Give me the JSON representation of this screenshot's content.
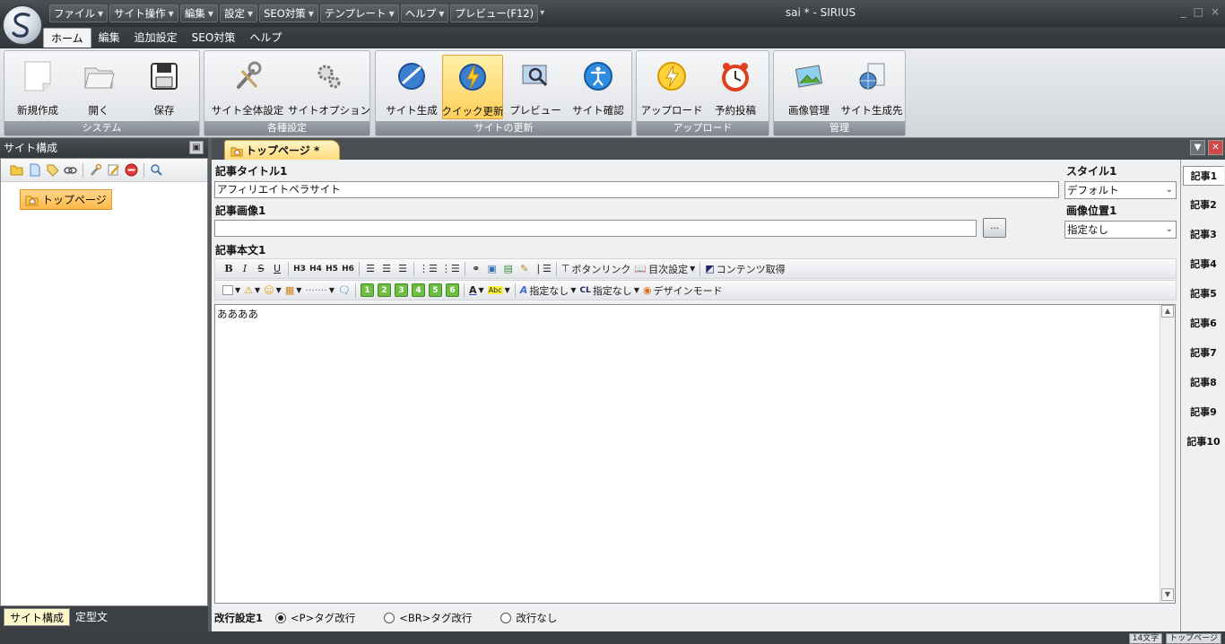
{
  "window": {
    "title": "sai * - SIRIUS",
    "minimize": "_",
    "maximize": "□",
    "close": "×"
  },
  "quick_access": [
    "ファイル",
    "サイト操作",
    "編集",
    "設定",
    "SEO対策",
    "テンプレート",
    "ヘルプ",
    "プレビュー(F12)"
  ],
  "ribbon_tabs": [
    "ホーム",
    "編集",
    "追加設定",
    "SEO対策",
    "ヘルプ"
  ],
  "ribbon": {
    "groups": [
      {
        "label": "システム",
        "buttons": [
          "新規作成",
          "開く",
          "保存"
        ]
      },
      {
        "label": "各種設定",
        "buttons": [
          "サイト全体設定",
          "サイトオプション"
        ]
      },
      {
        "label": "サイトの更新",
        "buttons": [
          "サイト生成",
          "クイック更新",
          "プレビュー",
          "サイト確認"
        ]
      },
      {
        "label": "アップロード",
        "buttons": [
          "アップロード",
          "予約投稿"
        ]
      },
      {
        "label": "管理",
        "buttons": [
          "画像管理",
          "サイト生成先"
        ]
      }
    ]
  },
  "left_panel": {
    "title": "サイト構成",
    "tree_root": "トップページ",
    "bottom_tabs": [
      "サイト構成",
      "定型文"
    ]
  },
  "doc_tab": "トップページ *",
  "editor": {
    "title_label": "記事タイトル1",
    "title_value": "アフィリエイトペラサイト",
    "style_label": "スタイル1",
    "style_value": "デフォルト",
    "image_label": "記事画像1",
    "image_value": "",
    "browse_label": "...",
    "image_pos_label": "画像位置1",
    "image_pos_value": "指定なし",
    "body_label": "記事本文1",
    "body_text": "ああああ",
    "toolbar1": {
      "bold": "B",
      "italic": "I",
      "strike": "S",
      "underline": "U",
      "h3": "H3",
      "h4": "H4",
      "h5": "H5",
      "h6": "H6",
      "button_link": "ボタンリンク",
      "toc": "目次設定",
      "content_fetch": "コンテンツ取得"
    },
    "toolbar2": {
      "numbers": [
        "1",
        "2",
        "3",
        "4",
        "5",
        "6"
      ],
      "font_none": "指定なし",
      "cl_none": "指定なし",
      "design_mode": "デザインモード",
      "line_style": "·······"
    },
    "linebreak": {
      "label": "改行設定1",
      "options": [
        "<P>タグ改行",
        "<BR>タグ改行",
        "改行なし"
      ],
      "selected": 0
    }
  },
  "article_tabs": [
    "記事1",
    "記事2",
    "記事3",
    "記事4",
    "記事5",
    "記事6",
    "記事7",
    "記事8",
    "記事9",
    "記事10"
  ],
  "status": [
    "14文字",
    "トップページ"
  ]
}
